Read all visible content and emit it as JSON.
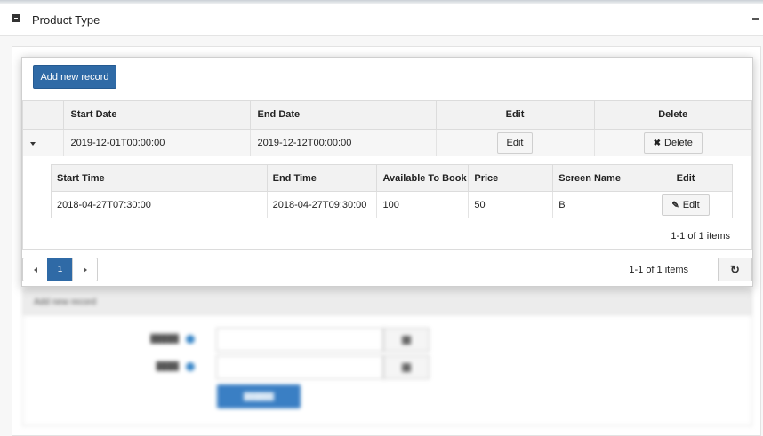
{
  "header": {
    "title": "Product Type"
  },
  "toolbar": {
    "add_label": "Add new record"
  },
  "outer_table": {
    "columns": [
      "Start Date",
      "End Date",
      "Edit",
      "Delete"
    ],
    "rows": [
      {
        "start_date": "2019-12-01T00:00:00",
        "end_date": "2019-12-12T00:00:00",
        "edit_label": "Edit",
        "delete_label": "Delete"
      }
    ]
  },
  "inner_table": {
    "columns": [
      "Start Time",
      "End Time",
      "Available To Book",
      "Price",
      "Screen Name",
      "Edit"
    ],
    "rows": [
      {
        "start_time": "2018-04-27T07:30:00",
        "end_time": "2018-04-27T09:30:00",
        "available": "100",
        "price": "50",
        "screen": "B",
        "edit_label": "Edit"
      }
    ],
    "count_text": "1-1 of 1 items"
  },
  "pager": {
    "page": "1",
    "count_text": "1-1 of 1 items"
  },
  "form": {
    "title": "Add new record"
  },
  "icons": {
    "delete": "times-icon",
    "edit": "pencil-icon",
    "refresh": "refresh-icon"
  }
}
